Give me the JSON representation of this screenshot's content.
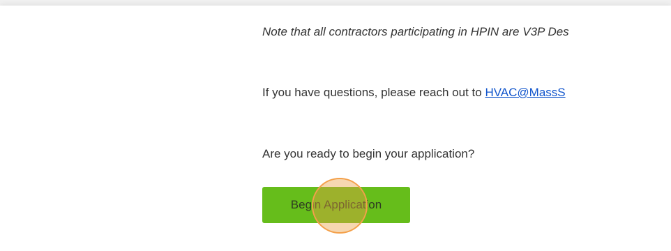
{
  "content": {
    "note_text": "Note that all contractors participating in HPIN are V3P Des",
    "question_prefix": "If you have questions, please reach out to ",
    "contact_email": "HVAC@MassS",
    "ready_prompt": "Are you ready to begin your application?",
    "begin_button_label": "Begin Application"
  },
  "colors": {
    "button": "#66bd1b",
    "link": "#1155cc",
    "click_highlight": "#f4a04a"
  }
}
